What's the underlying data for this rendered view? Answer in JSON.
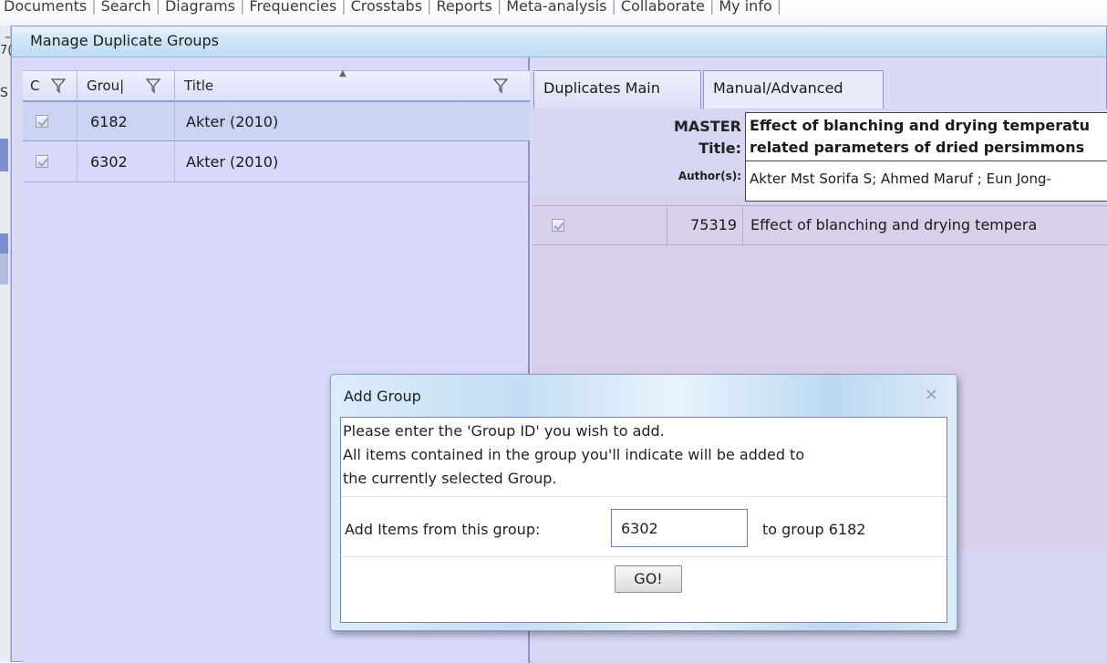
{
  "top_menu": {
    "items": [
      "Documents",
      "Search",
      "Diagrams",
      "Frequencies",
      "Crosstabs",
      "Reports",
      "Meta-analysis",
      "Collaborate",
      "My info"
    ]
  },
  "background": {
    "left_letter_1": "7(",
    "left_letter_2": "S"
  },
  "window": {
    "title": "Manage Duplicate Groups"
  },
  "groups_grid": {
    "columns": [
      "C",
      "Grou|",
      "Title"
    ],
    "rows": [
      {
        "group_id": "6182",
        "title": "Akter (2010)",
        "checked": true,
        "selected": true
      },
      {
        "group_id": "6302",
        "title": "Akter (2010)",
        "checked": true,
        "selected": false
      }
    ]
  },
  "tabs": [
    "Duplicates Main",
    "Manual/Advanced"
  ],
  "details": {
    "master_label": "MASTER Title:",
    "master_title": "Effect of blanching and drying temperatu related parameters of dried persimmons",
    "authors_label": "Author(s):",
    "authors_value": "Akter Mst Sorifa S; Ahmed Maruf ; Eun Jong-",
    "item_id": "75319",
    "item_title": "Effect of blanching and drying tempera"
  },
  "dialog": {
    "title": "Add Group",
    "message_line1": "Please enter the 'Group ID' you wish to add.",
    "message_line2": "All items contained in the group you'll indicate will be added to",
    "message_line3": "the currently selected Group.",
    "add_label": "Add Items from this group:",
    "input_value": "6302",
    "to_group_text": "to group 6182",
    "go_label": "GO!"
  }
}
